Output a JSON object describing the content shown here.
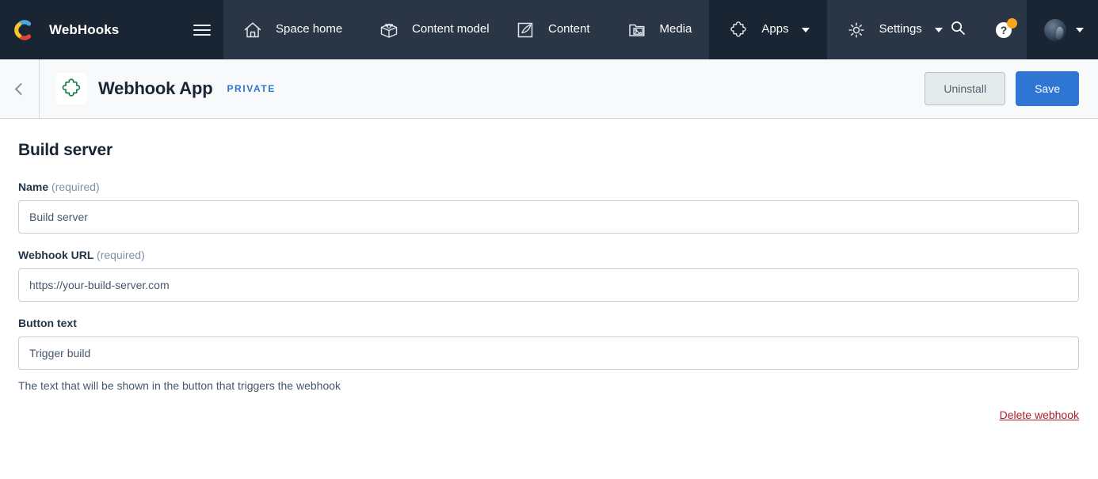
{
  "topnav": {
    "brand": {
      "logo_icon": "contentful-logo-icon",
      "title": "WebHooks",
      "menu_icon": "hamburger-menu-icon"
    },
    "items": [
      {
        "label": "Space home",
        "icon": "home-icon",
        "active": false,
        "caret": false
      },
      {
        "label": "Content model",
        "icon": "content-model-box-icon",
        "active": false,
        "caret": false
      },
      {
        "label": "Content",
        "icon": "content-pen-icon",
        "active": false,
        "caret": false
      },
      {
        "label": "Media",
        "icon": "media-image-icon",
        "active": false,
        "caret": false
      },
      {
        "label": "Apps",
        "icon": "apps-puzzle-icon",
        "active": true,
        "caret": true
      },
      {
        "label": "Settings",
        "icon": "settings-gear-icon",
        "active": false,
        "caret": true
      }
    ],
    "search_icon": "search-icon",
    "help_icon": "help-question-icon",
    "help_badge_color": "#f5a623",
    "avatar_icon": "user-avatar",
    "avatar_caret_icon": "chevron-down-icon",
    "colors": {
      "bar": "#2a3646",
      "panel": "#192532"
    }
  },
  "subheader": {
    "back_icon": "chevron-left-icon",
    "app_icon": "puzzle-piece-icon",
    "app_icon_color": "#1a7f4b",
    "title": "Webhook App",
    "badge": "PRIVATE",
    "badge_color": "#2e75d4",
    "uninstall_label": "Uninstall",
    "save_label": "Save",
    "save_color": "#2e75d4"
  },
  "main": {
    "page_title": "Build server",
    "fields": [
      {
        "label": "Name",
        "required_text": "(required)",
        "value": "Build server",
        "placeholder": "Name",
        "helper": ""
      },
      {
        "label": "Webhook URL",
        "required_text": "(required)",
        "value": "https://your-build-server.com",
        "placeholder": "https://your-build-server.com",
        "helper": ""
      },
      {
        "label": "Button text",
        "required_text": "",
        "value": "Trigger build",
        "placeholder": "Button text",
        "helper": "The text that will be shown in the button that triggers the webhook"
      }
    ],
    "delete_label": "Delete webhook",
    "delete_color": "#a8202a"
  }
}
